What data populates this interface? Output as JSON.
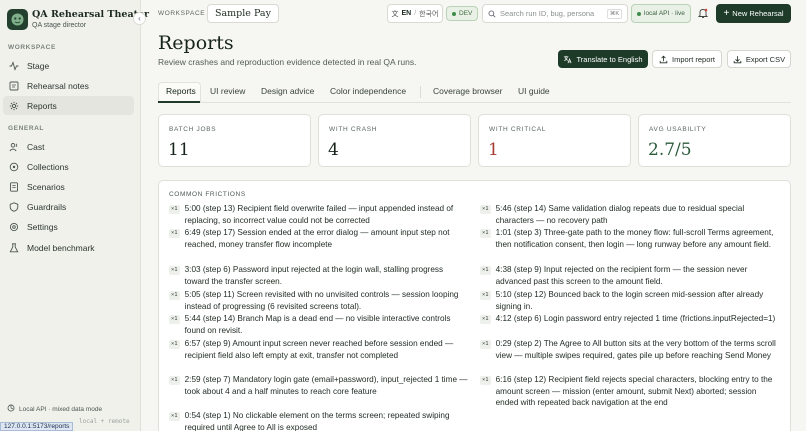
{
  "brand": {
    "name": "QA Rehearsal Theater",
    "subtitle": "QA stage director"
  },
  "sidebar": {
    "workspace_label": "WORKSPACE",
    "workspace_items": [
      {
        "label": "Stage",
        "icon": "activity-icon"
      },
      {
        "label": "Rehearsal notes",
        "icon": "notes-icon"
      },
      {
        "label": "Reports",
        "icon": "gear-icon",
        "active": true
      }
    ],
    "general_label": "GENERAL",
    "general_items": [
      {
        "label": "Cast",
        "icon": "users-icon"
      },
      {
        "label": "Collections",
        "icon": "collection-icon"
      },
      {
        "label": "Scenarios",
        "icon": "scenario-icon"
      },
      {
        "label": "Guardrails",
        "icon": "shield-icon"
      },
      {
        "label": "Settings",
        "icon": "settings-icon"
      },
      {
        "label": "Model benchmark",
        "icon": "flask-icon"
      }
    ],
    "footer": "Local API · mixed data mode",
    "footer_secondary": "local + remote"
  },
  "statusbar": {
    "url": "127.0.0.1:5173/reports"
  },
  "topbar": {
    "workspace_label": "WORKSPACE",
    "workspace_value": "Sample Pay",
    "lang_primary": "EN",
    "lang_sep": "/",
    "lang_secondary": "한국어",
    "env_badge": "DEV",
    "search_placeholder": "Search run ID, bug, persona",
    "search_shortcut": "⌘K",
    "api_status": "local API · live",
    "new_button": "New Rehearsal"
  },
  "page": {
    "title": "Reports",
    "subtitle": "Review crashes and reproduction evidence detected in real QA runs.",
    "translate_button": "Translate to English",
    "import_button": "Import report",
    "export_button": "Export CSV"
  },
  "tabs": [
    "Reports",
    "UI review",
    "Design advice",
    "Color independence",
    "Coverage browser",
    "UI guide"
  ],
  "stats": [
    {
      "label": "BATCH JOBS",
      "value": "11",
      "tone": "default"
    },
    {
      "label": "WITH CRASH",
      "value": "4",
      "tone": "default"
    },
    {
      "label": "WITH CRITICAL",
      "value": "1",
      "tone": "red"
    },
    {
      "label": "AVG USABILITY",
      "value": "2.7/5",
      "tone": "green"
    }
  ],
  "frictions": {
    "title": "COMMON FRICTIONS",
    "badge": "×1",
    "left": [
      "5:00 (step 13) Recipient field overwrite failed — input appended instead of replacing, so incorrect value could not be corrected",
      "6:49 (step 17) Session ended at the error dialog — amount input step not reached, money transfer flow incomplete",
      "3:03 (step 6) Password input rejected at the login wall, stalling progress toward the transfer screen.",
      "5:05 (step 11) Screen revisited with no unvisited controls — session looping instead of progressing (6 revisited screens total).",
      "5:44 (step 14) Branch Map is a dead end — no visible interactive controls found on revisit.",
      "6:57 (step 9) Amount input screen never reached before session ended — recipient field also left empty at exit, transfer not completed",
      "2:59 (step 7) Mandatory login gate (email+password), input_rejected 1 time — took about 4 and a half minutes to reach core feature",
      "0:54 (step 1) No clickable element on the terms screen; repeated swiping required until Agree to All is exposed"
    ],
    "right": [
      "5:46 (step 14) Same validation dialog repeats due to residual special characters — no recovery path",
      "1:01 (step 3) Three-gate path to the money flow: full-scroll Terms agreement, then notification consent, then login — long runway before any amount field.",
      "4:38 (step 9) Input rejected on the recipient form — the session never advanced past this screen to the amount field.",
      "5:10 (step 12) Bounced back to the login screen mid-session after already signing in.",
      "4:12 (step 6) Login password entry rejected 1 time (frictions.inputRejected=1)",
      "0:29 (step 2) The Agree to All button sits at the very bottom of the terms scroll view — multiple swipes required, gates pile up before reaching Send Money",
      "6:16 (step 12) Recipient field rejects special characters, blocking entry to the amount screen — mission (enter amount, submit Next) aborted; session ended with repeated back navigation at the end"
    ]
  }
}
